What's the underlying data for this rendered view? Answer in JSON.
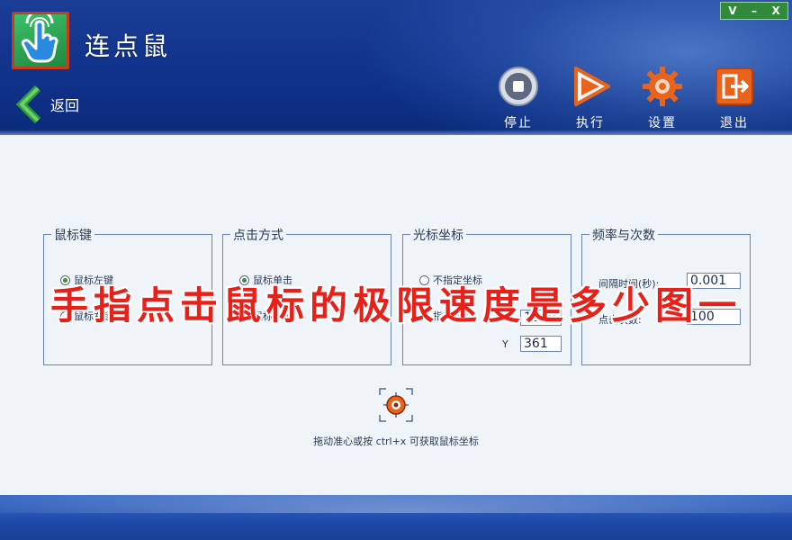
{
  "window": {
    "controls": [
      "V",
      "–",
      "X"
    ]
  },
  "header": {
    "app_title": "连点鼠",
    "back_label": "返回",
    "toolbar": [
      {
        "label": "停止",
        "icon": "stop-icon"
      },
      {
        "label": "执行",
        "icon": "play-icon"
      },
      {
        "label": "设置",
        "icon": "gear-icon"
      },
      {
        "label": "退出",
        "icon": "exit-icon"
      }
    ]
  },
  "groups": {
    "mouse_button": {
      "title": "鼠标键",
      "options": [
        {
          "label": "鼠标左键",
          "selected": true
        },
        {
          "label": "鼠标右键",
          "selected": false
        }
      ]
    },
    "click_mode": {
      "title": "点击方式",
      "options": [
        {
          "label": "鼠标单击",
          "selected": true
        },
        {
          "label": "鼠标双击",
          "selected": false
        }
      ]
    },
    "cursor_coords": {
      "title": "光标坐标",
      "options": [
        {
          "label": "不指定坐标",
          "selected": false
        },
        {
          "label": "指定坐标",
          "selected": true
        }
      ],
      "x_label": "X",
      "x_value": "1549",
      "y_label": "Y",
      "y_value": "361"
    },
    "frequency": {
      "title": "频率与次数",
      "interval_label": "间隔时间(秒):",
      "interval_value": "0.001",
      "count_label": "点击次数:",
      "count_value": "100"
    }
  },
  "crosshair": {
    "icon": "crosshair-icon",
    "hint": "拖动准心或按 ctrl+x 可获取鼠标坐标"
  },
  "overlay_caption": "手指点击鼠标的极限速度是多少图一",
  "colors": {
    "header": "#10328a",
    "accent_green": "#2f8a3a",
    "caption_red": "#e8201a",
    "toolbar_orange": "#e8641c"
  }
}
